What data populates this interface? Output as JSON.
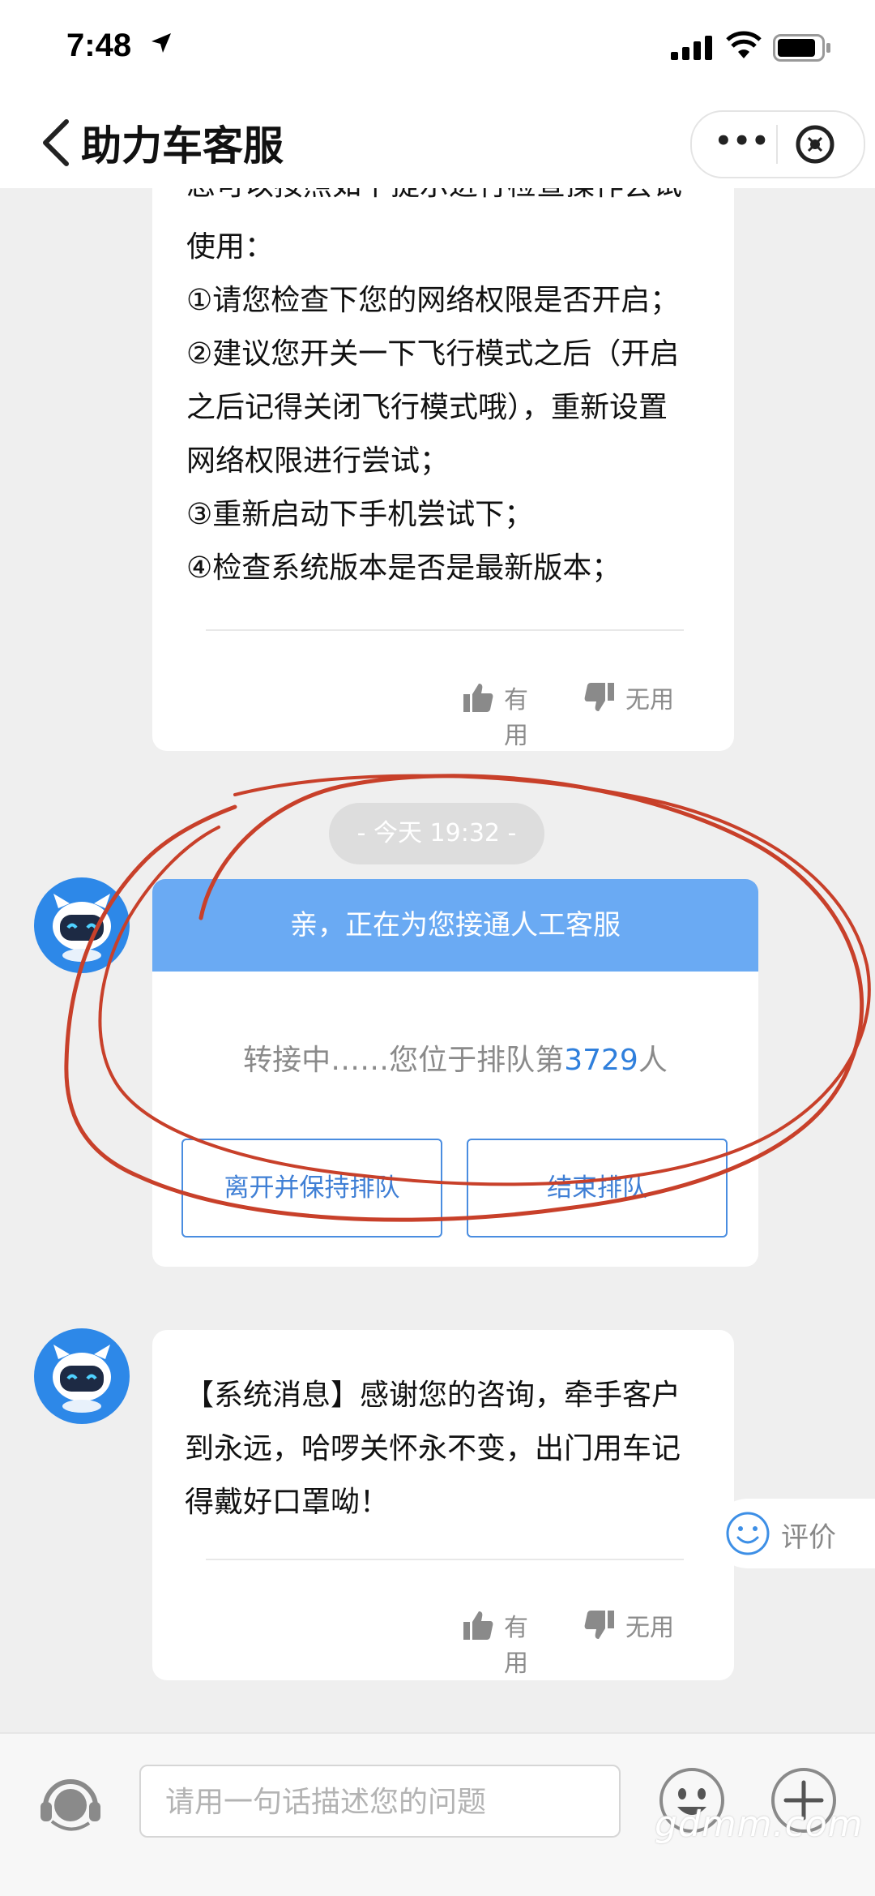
{
  "status": {
    "time": "7:48"
  },
  "nav": {
    "title": "助力车客服",
    "more": "•••"
  },
  "message1": {
    "partial_top": "您可以按照如下提示进行检查操作尝试",
    "lines": [
      "使用：",
      "①请您检查下您的网络权限是否开启；",
      "②建议您开关一下飞行模式之后（开启",
      "之后记得关闭飞行模式哦），重新设置",
      "网络权限进行尝试；",
      "③重新启动下手机尝试下；",
      "④检查系统版本是否是最新版本；"
    ],
    "useful": "有用",
    "useless": "无用"
  },
  "timestamp": "- 今天 19:32 -",
  "queue": {
    "header": "亲，正在为您接通人工客服",
    "status_prefix": "转接中……您位于排队第",
    "position": "3729",
    "status_suffix": "人",
    "leave_button": "离开并保持排队",
    "end_button": "结束排队"
  },
  "message2": {
    "lines": [
      "【系统消息】感谢您的咨询，牵手客户",
      "到永远，哈啰关怀永不变，出门用车记",
      "得戴好口罩呦！"
    ],
    "useful": "有用",
    "useless": "无用"
  },
  "rate_label": "评价",
  "input": {
    "placeholder": "请用一句话描述您的问题"
  },
  "watermark": "gdmm.com",
  "colors": {
    "accent": "#2f7fdc",
    "queue_header": "#6aaaf3",
    "annotation": "#c8402a"
  }
}
